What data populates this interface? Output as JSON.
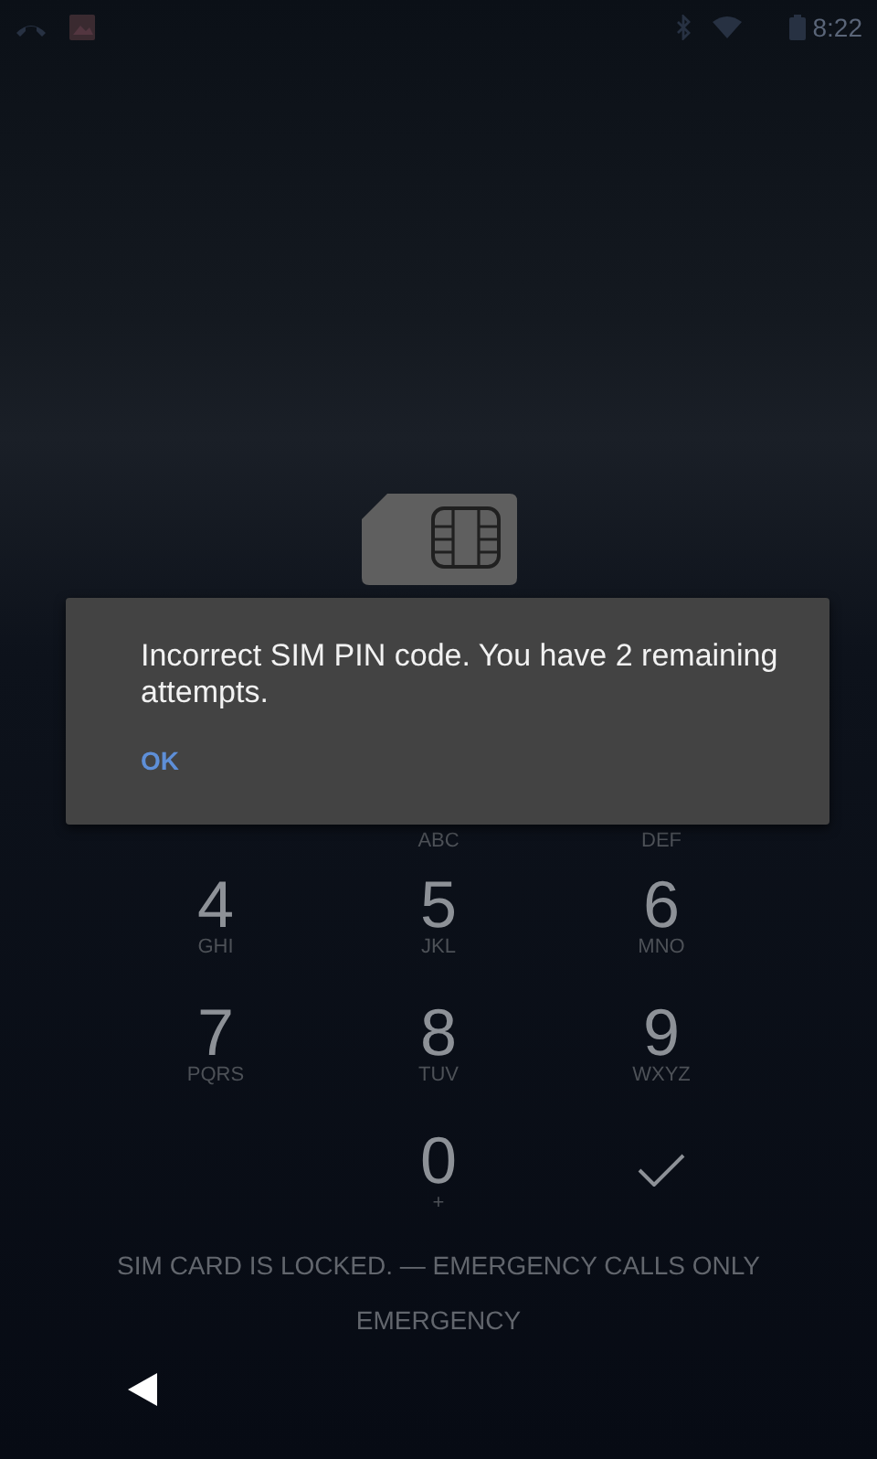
{
  "status_bar": {
    "time": "8:22"
  },
  "dialog": {
    "message": "Incorrect SIM PIN code. You have 2 remaining attempts.",
    "button": "OK"
  },
  "keypad_rows": [
    [
      {
        "kind": "digit",
        "letters": "ABC"
      },
      {
        "kind": "digit",
        "letters": "DEF"
      }
    ],
    [
      {
        "kind": "digit",
        "digit": "4",
        "letters": "GHI"
      },
      {
        "kind": "digit",
        "digit": "5",
        "letters": "JKL"
      },
      {
        "kind": "digit",
        "digit": "6",
        "letters": "MNO"
      }
    ],
    [
      {
        "kind": "digit",
        "digit": "7",
        "letters": "PQRS"
      },
      {
        "kind": "digit",
        "digit": "8",
        "letters": "TUV"
      },
      {
        "kind": "digit",
        "digit": "9",
        "letters": "WXYZ"
      }
    ],
    [
      {
        "kind": "digit",
        "digit": "0",
        "letters": "+"
      },
      {
        "kind": "enter"
      }
    ]
  ],
  "carrier_text": "SIM CARD IS LOCKED. — EMERGENCY CALLS ONLY",
  "emergency_button": "EMERGENCY"
}
